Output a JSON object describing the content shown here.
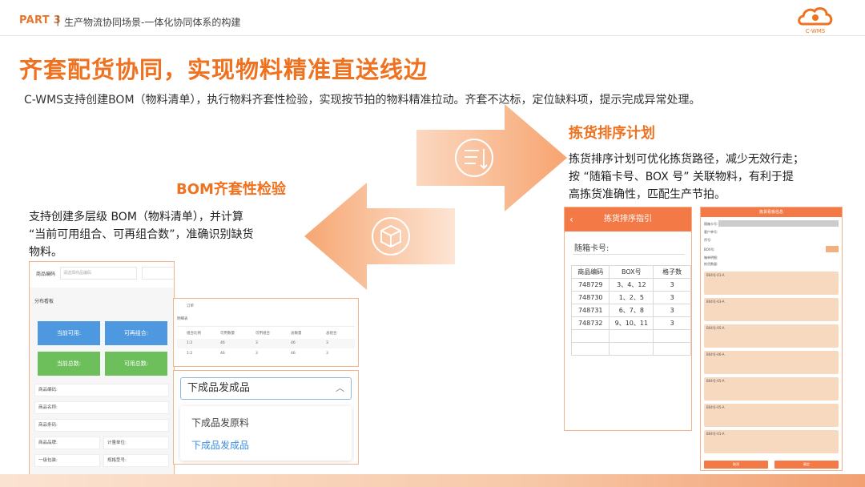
{
  "header": {
    "part": "PART 3",
    "separator": "|",
    "subtitle": "生产物流协同场景-一体化协同体系的构建",
    "logo_text": "C-WMS",
    "brand_color": "#ee7220"
  },
  "title": "齐套配货协同，实现物料精准直送线边",
  "description": "C-WMS支持创建BOM（物料清单），执行物料齐套性检验，实现按节拍的物料精准拉动。齐套不达标，定位缺料项，提示完成异常处理。",
  "pick_section": {
    "title": "拣货排序计划",
    "lines": [
      "拣货排序计划可优化拣货路径，减少无效行走；",
      "按 “随箱卡号、BOX 号” 关联物料，有利于提",
      "高拣货准确性，匹配生产节拍。"
    ],
    "icon": "list-sort-icon"
  },
  "bom_section": {
    "title": "BOM齐套性检验",
    "lines": [
      "支持创建多层级 BOM（物料清单），并计算",
      "“当前可用组合、可再组合数”，准确识别缺货",
      "物料。"
    ],
    "icon": "box-icon"
  },
  "bom_form": {
    "goods_code_label": "商品编码",
    "goods_code_placeholder": "请选择商品编码",
    "panel_label": "分布看板",
    "tiles": [
      "当前可用:",
      "可再组合:",
      "当前总数:",
      "可用总数:"
    ],
    "rows": [
      "商品编码:",
      "商品名称:",
      "商品条码:",
      "商品品牌:",
      "一级包装:"
    ],
    "row_extra": [
      "计量单位:",
      "规格型号:"
    ]
  },
  "bom_table": {
    "tab": "订单",
    "section": "明细表",
    "headers": [
      "组合比例",
      "可用数量",
      "可用组合",
      "总数量",
      "总组合"
    ],
    "rows": [
      [
        "1:2",
        "46",
        "3",
        "46",
        "3"
      ],
      [
        "1:2",
        "46",
        "3",
        "46",
        "3"
      ]
    ]
  },
  "dropdown": {
    "selected": "下成品发成品",
    "options": [
      "下成品发原料",
      "下成品发成品"
    ],
    "active_color": "#3c8dd9"
  },
  "sort_phone": {
    "title": "拣货排序指引",
    "card_label": "随箱卡号:",
    "headers": [
      "商品编码",
      "BOX号",
      "格子数"
    ],
    "rows": [
      [
        "748729",
        "3、4、12",
        "3"
      ],
      [
        "748730",
        "1、2、5",
        "3"
      ],
      [
        "748731",
        "6、7、8",
        "3"
      ],
      [
        "748732",
        "9、10、11",
        "3"
      ]
    ]
  },
  "pick_phone": {
    "title": "拣货看板信息",
    "fields": [
      "随箱卡号:",
      "客户单号:",
      "序号:",
      "BOX号:",
      "箱单明细:",
      "拣货数量:"
    ],
    "items": [
      "B04号-01-A",
      "B04号-03-A",
      "B04号-05-A",
      "B04号-06-A",
      "B04号-05-A",
      "B04号-05-A",
      "B04号-01-A"
    ],
    "buttons": [
      "取消",
      "确定"
    ]
  }
}
